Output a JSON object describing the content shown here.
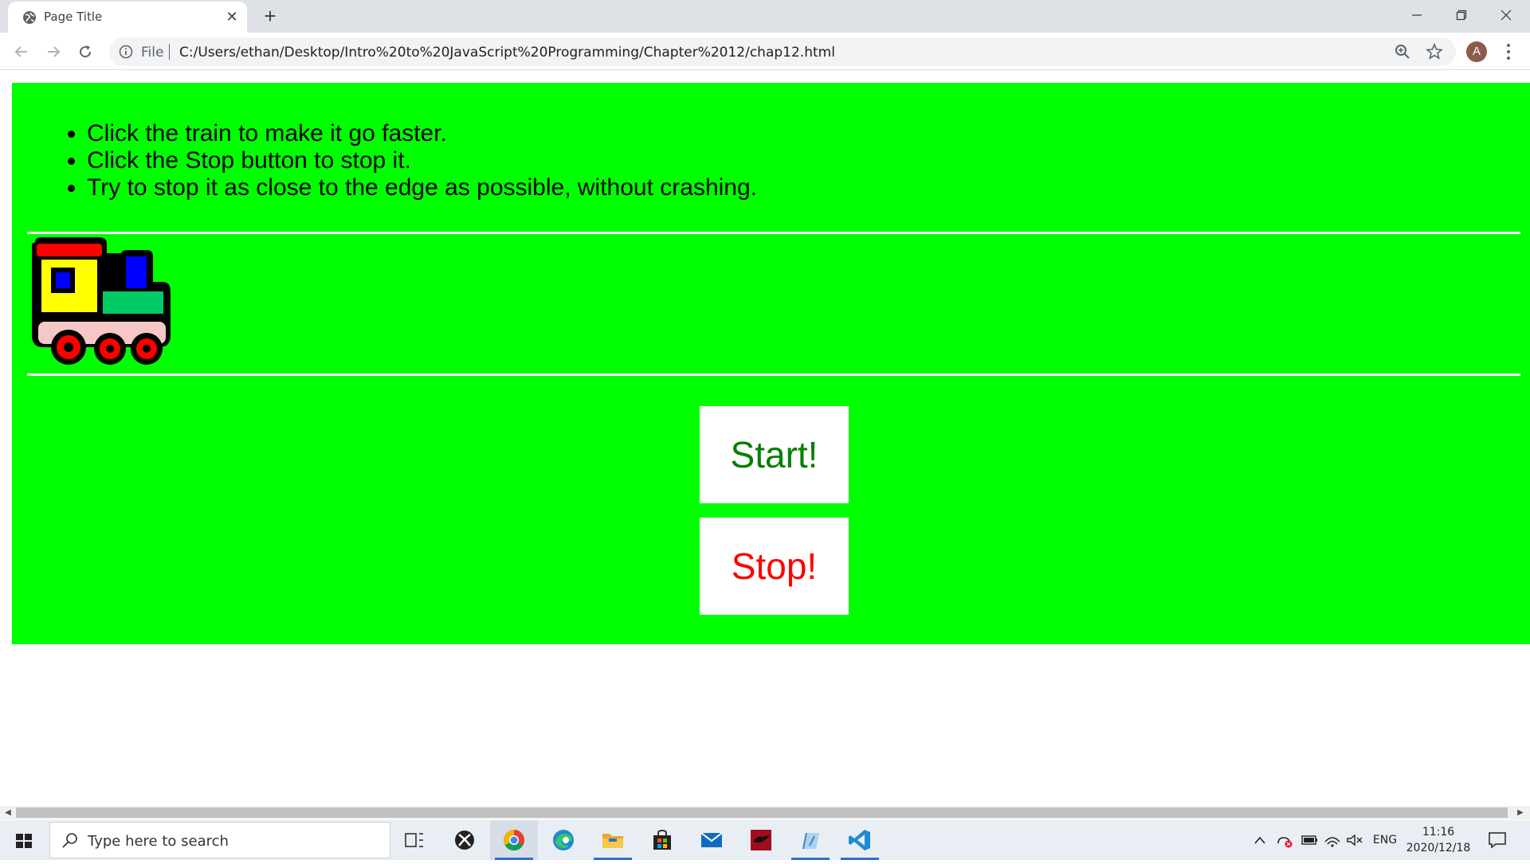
{
  "browser": {
    "tab_title": "Page Title",
    "new_tab_label": "+",
    "omnibox_scheme": "File",
    "url": "C:/Users/ethan/Desktop/Intro%20to%20JavaScript%20Programming/Chapter%2012/chap12.html",
    "profile_initial": "A"
  },
  "page": {
    "background_color": "#00ff00",
    "instructions": [
      "Click the train to make it go faster.",
      "Click the Stop button to stop it.",
      "Try to stop it as close to the edge as possible, without crashing."
    ],
    "start_label": "Start!",
    "stop_label": "Stop!",
    "start_color": "#008000",
    "stop_color": "#ff0000",
    "train_icon": "train-icon"
  },
  "taskbar": {
    "search_placeholder": "Type here to search",
    "language": "ENG",
    "time": "11:16",
    "date": "2020/12/18",
    "apps": [
      "task-view-icon",
      "xbox-icon",
      "chrome-icon",
      "edge-icon",
      "file-explorer-icon",
      "store-icon",
      "mail-icon",
      "game-app-icon",
      "notepad-icon",
      "vscode-icon"
    ]
  }
}
